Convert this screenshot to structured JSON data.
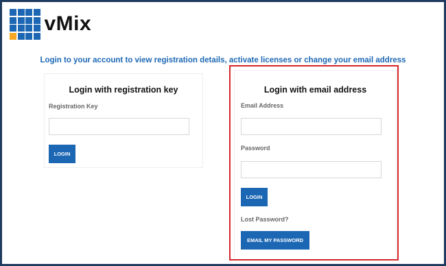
{
  "brand": {
    "name": "vMix",
    "logo_colors": [
      "#1c67b4",
      "#1c67b4",
      "#1c67b4",
      "#1c67b4",
      "#1c67b4",
      "#1c67b4",
      "#1c67b4",
      "#1c67b4",
      "#1c67b4",
      "#1c67b4",
      "#1c67b4",
      "#1c67b4",
      "#f5a623",
      "#1c67b4",
      "#1c67b4",
      "#1c67b4"
    ]
  },
  "header": {
    "subtitle": "Login to your account to view registration details, activate licenses or change your email address"
  },
  "registration_card": {
    "title": "Login with registration key",
    "key_label": "Registration Key",
    "key_value": "",
    "login_label": "LOGIN"
  },
  "email_card": {
    "title": "Login with email address",
    "email_label": "Email Address",
    "email_value": "",
    "password_label": "Password",
    "password_value": "",
    "login_label": "LOGIN",
    "lost_password_label": "Lost Password?",
    "email_password_label": "EMAIL MY PASSWORD"
  },
  "colors": {
    "accent": "#1c67b4",
    "highlight": "#d42527",
    "frame": "#1f3a5f"
  }
}
